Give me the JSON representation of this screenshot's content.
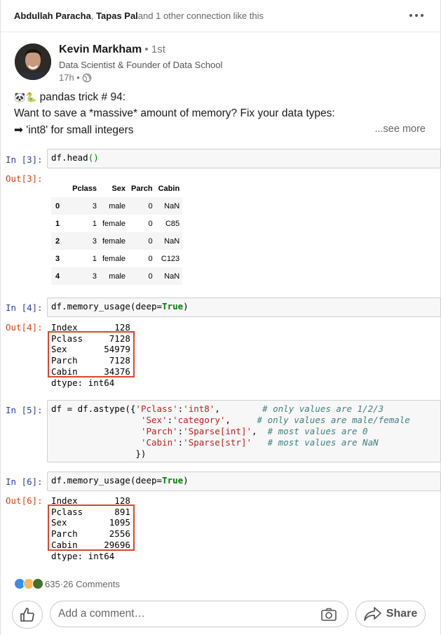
{
  "header": {
    "conn_name_1": "Abdullah Paracha",
    "conn_sep": ",",
    "conn_name_2": "Tapas Pal",
    "conn_rest": " and 1 other connection like this"
  },
  "author": {
    "name": "Kevin Markham",
    "degree": " • 1st",
    "headline": "Data Scientist & Founder of Data School",
    "time": "17h •"
  },
  "post": {
    "line1_emoji": "🐼🐍",
    "line1": " pandas trick # 94:",
    "line2": "Want to save a *massive* amount of memory? Fix your data types:",
    "line3_arrow": "➡",
    "line3": " 'int8' for small integers",
    "see_more": "...see more"
  },
  "notebook": {
    "in3": "In [3]:",
    "out3": "Out[3]:",
    "in4": "In [4]:",
    "out4": "Out[4]:",
    "in5": "In [5]:",
    "in6": "In [6]:",
    "out6": "Out[6]:",
    "code_df": "df",
    "code_head": ".head",
    "code_mem_call": "df.memory_usage(deep=",
    "code_true": "True",
    "code_close": ")",
    "table": {
      "columns": [
        "Pclass",
        "Sex",
        "Parch",
        "Cabin"
      ],
      "rows": [
        [
          "0",
          "3",
          "male",
          "0",
          "NaN"
        ],
        [
          "1",
          "1",
          "female",
          "0",
          "C85"
        ],
        [
          "2",
          "3",
          "female",
          "0",
          "NaN"
        ],
        [
          "3",
          "1",
          "female",
          "0",
          "C123"
        ],
        [
          "4",
          "3",
          "male",
          "0",
          "NaN"
        ]
      ]
    },
    "out4_lines": [
      "Index       128",
      "Pclass     7128",
      "Sex       54979",
      "Parch      7128",
      "Cabin     34376",
      "dtype: int64"
    ],
    "out6_lines": [
      "Index       128",
      "Pclass      891",
      "Sex        1095",
      "Parch      2556",
      "Cabin     29696",
      "dtype: int64"
    ],
    "astype": [
      {
        "prefix": "df = df.astype({",
        "key": "'Pclass'",
        "val": "'int8'",
        "comma": ",",
        "pad": "        ",
        "comment": "# only values are 1/2/3"
      },
      {
        "prefix": "                 ",
        "key": "'Sex'",
        "val": "'category'",
        "comma": ",",
        "pad": "     ",
        "comment": "# only values are male/female"
      },
      {
        "prefix": "                 ",
        "key": "'Parch'",
        "val": "'Sparse[int]'",
        "comma": ",",
        "pad": "  ",
        "comment": "# most values are 0"
      },
      {
        "prefix": "                 ",
        "key": "'Cabin'",
        "val": "'Sparse[str]'",
        "comma": "",
        "pad": "   ",
        "comment": "# most values are NaN"
      }
    ],
    "astype_close": "                })"
  },
  "social": {
    "reaction_count": "635",
    "sep": " · ",
    "comments": "26 Comments",
    "comment_placeholder": "Add a comment…",
    "share_label": "Share"
  },
  "icons": {
    "more": "more-horizontal-icon",
    "globe": "globe-icon",
    "like": "thumbs-up-icon",
    "camera": "camera-icon",
    "share": "share-arrow-icon"
  },
  "colors": {
    "in_prompt": "#303f9f",
    "out_prompt": "#d84315",
    "highlight_box": "#d9472e"
  }
}
